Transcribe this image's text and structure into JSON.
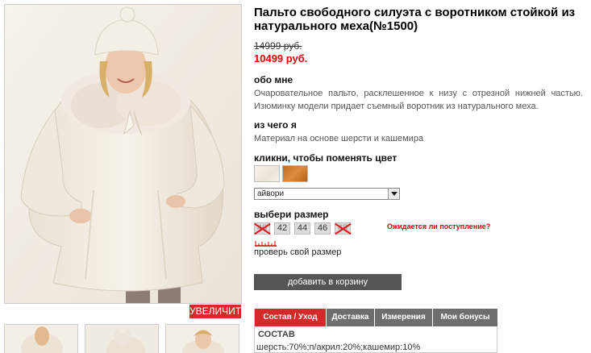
{
  "product": {
    "title": "Пальто свободного силуэта с воротником стойкой из натурального меха(№1500)",
    "old_price": "14999 руб.",
    "new_price": "10499 руб."
  },
  "about": {
    "heading": "обо мне",
    "text": "Очаровательное пальто, расклешенное к низу с отрезной нижней частью. Изюминку модели придает съемный воротник из натурального меха."
  },
  "material": {
    "heading": "из чего я",
    "text": "Материал на основе шерсти и кашемира"
  },
  "colors": {
    "heading": "кликни, чтобы поменять цвет",
    "selected": "айвори",
    "swatches": [
      {
        "name": "ivory",
        "color": "#f3eee4"
      },
      {
        "name": "camel",
        "color": "#c9712a"
      }
    ]
  },
  "sizes": {
    "heading": "выбери размер",
    "items": [
      {
        "label": "40",
        "available": false
      },
      {
        "label": "42",
        "available": true
      },
      {
        "label": "44",
        "available": true
      },
      {
        "label": "46",
        "available": true
      },
      {
        "label": "48",
        "available": false
      }
    ],
    "awaiting_link": "Ожидается ли поступление?",
    "check_size": "проверь свой размер"
  },
  "photo": {
    "zoom_label": "УВЕЛИЧИТЬ"
  },
  "cart": {
    "add_label": "добавить в корзину"
  },
  "tabs": [
    {
      "label": "Состав / Уход",
      "active": true
    },
    {
      "label": "Доставка",
      "active": false
    },
    {
      "label": "Измерения",
      "active": false
    },
    {
      "label": "Мои бонусы",
      "active": false
    }
  ],
  "composition": {
    "title": "СОСТАВ",
    "text": "шерсть:70%;п/акрил:20%;кашемир:10%"
  },
  "theme": {
    "accent": "#d52a2a",
    "price_red": "#e00000",
    "button_gray": "#555555"
  }
}
